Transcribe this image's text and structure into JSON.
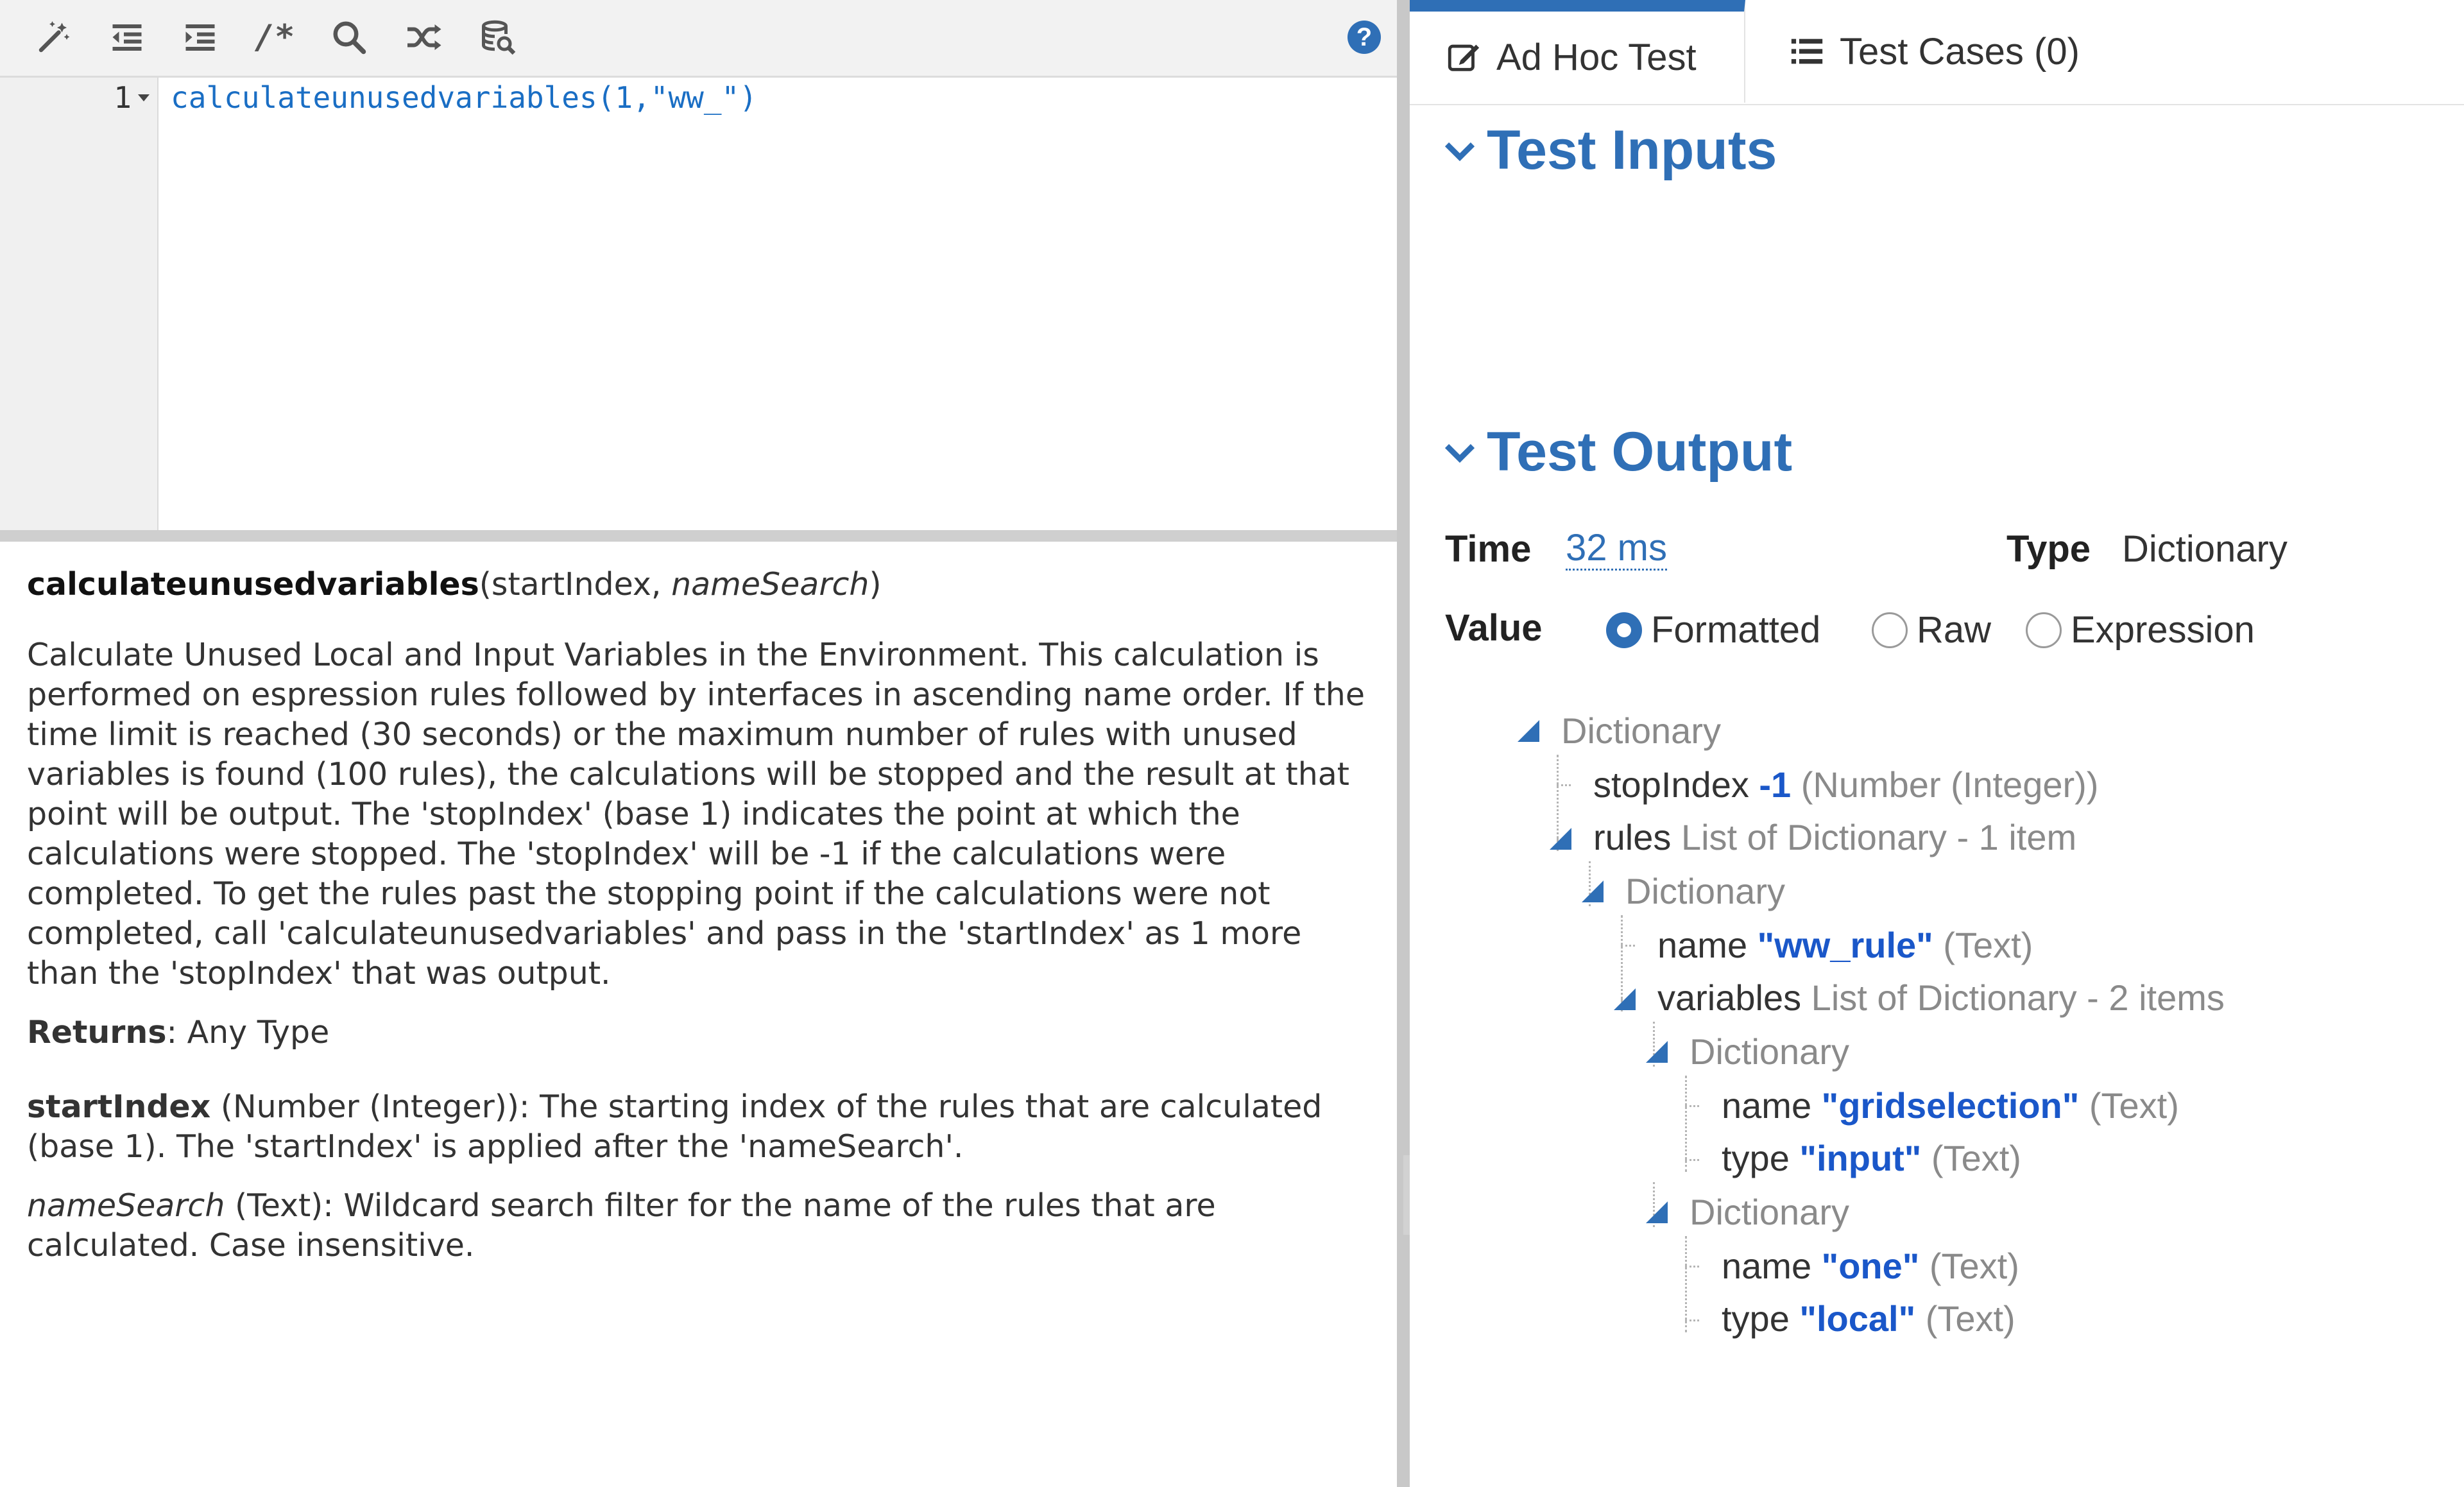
{
  "toolbar": {
    "icons": [
      "magic-wand-icon",
      "outdent-icon",
      "indent-icon",
      "comment-icon",
      "search-icon",
      "shuffle-icon",
      "database-search-icon"
    ],
    "comment_glyph": "/*",
    "help_glyph": "?"
  },
  "editor": {
    "line_number": "1",
    "code": {
      "fn": "calculateunusedvariables",
      "args": "(1,",
      "str": "\"ww_\"",
      "close": ")"
    }
  },
  "doc": {
    "signature_name": "calculateunusedvariables",
    "signature_open": "(startIndex, ",
    "signature_param2": "nameSearch",
    "signature_close": ")",
    "description": "Calculate Unused Local and Input Variables in the Environment. This calculation is performed on espression rules followed by interfaces in ascending name order. If the time limit is reached (30 seconds) or the maximum number of rules with unused variables is found (100 rules), the calculations will be stopped and the result at that point will be output. The 'stopIndex' (base 1) indicates the point at which the calculations were stopped. The 'stopIndex' will be -1 if the calculations were completed. To get the rules past the stopping point if the calculations were not completed, call 'calculateunusedvariables' and pass in the 'startIndex' as 1 more than the 'stopIndex' that was output.",
    "returns_label": "Returns",
    "returns_value": ": Any Type",
    "param1_name": "startIndex",
    "param1_desc": " (Number (Integer)): The starting index of the rules that are calculated (base 1). The 'startIndex' is applied after the 'nameSearch'.",
    "param2_name": "nameSearch",
    "param2_desc": " (Text): Wildcard search filter for the name of the rules that are calculated. Case insensitive."
  },
  "tabs": {
    "adhoc": "Ad Hoc Test",
    "cases": "Test Cases (0)"
  },
  "sections": {
    "inputs": "Test Inputs",
    "output": "Test Output"
  },
  "output": {
    "time_label": "Time",
    "time_value": "32 ms",
    "type_label": "Type",
    "type_value": "Dictionary",
    "value_label": "Value",
    "radio_options": [
      "Formatted",
      "Raw",
      "Expression"
    ],
    "selected_radio": "Formatted"
  },
  "tree": [
    {
      "key": "Dictionary",
      "value": "",
      "type": ""
    },
    {
      "key": "stopIndex",
      "value": "-1",
      "type": "(Number (Integer))"
    },
    {
      "key": "rules",
      "value": "",
      "type": "List of Dictionary - 1 item"
    },
    {
      "key": "Dictionary",
      "value": "",
      "type": ""
    },
    {
      "key": "name",
      "value": "\"ww_rule\"",
      "type": "(Text)"
    },
    {
      "key": "variables",
      "value": "",
      "type": "List of Dictionary - 2 items"
    },
    {
      "key": "Dictionary",
      "value": "",
      "type": ""
    },
    {
      "key": "name",
      "value": "\"gridselection\"",
      "type": "(Text)"
    },
    {
      "key": "type",
      "value": "\"input\"",
      "type": "(Text)"
    },
    {
      "key": "Dictionary",
      "value": "",
      "type": ""
    },
    {
      "key": "name",
      "value": "\"one\"",
      "type": "(Text)"
    },
    {
      "key": "type",
      "value": "\"local\"",
      "type": "(Text)"
    }
  ],
  "colors": {
    "accent": "#2f6fb6",
    "value_blue": "#1a57c9",
    "muted": "#8a8a8a"
  }
}
